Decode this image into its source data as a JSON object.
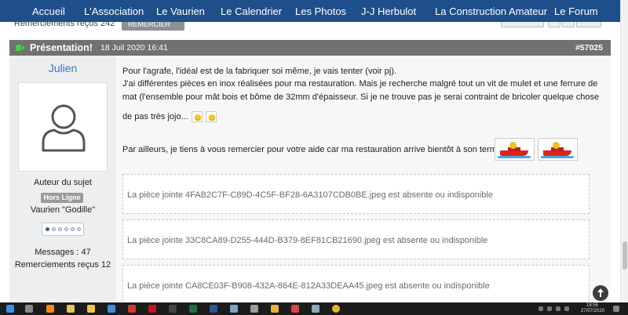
{
  "nav": {
    "items": [
      "Accueil",
      "L'Association",
      "Le Vaurien",
      "Le Calendrier",
      "Les Photos",
      "J-J Herbulot",
      "La Construction Amateur",
      "Le Forum"
    ]
  },
  "prev_post": {
    "thanks_text": "Remerciements reçus 242",
    "button_label": "REMERCIER"
  },
  "post": {
    "title": "Présentation!",
    "date": "18 Juil 2020 16:41",
    "number": "#57025",
    "author": {
      "name": "Julien",
      "role": "Auteur du sujet",
      "status": "Hors Ligne",
      "rank": "Vaurien \"Godille\"",
      "messages": "Messages : 47",
      "thanks": "Remerciements reçus 12"
    },
    "paragraphs": [
      "Pour l'agrafe, l'idéal est de la fabriquer soi même, je vais tenter (voir pj).",
      "J'ai différentes pièces en inox réalisées pour ma restauration. Mais je recherche malgré tout un vit de mulet et une ferrure de",
      "mat (l'ensemble pour mât bois et bôme de 32mm d'épaisseur. Si je ne trouve pas je serai contraint de bricoler quelque chose",
      "de pas très jojo...",
      "Par ailleurs, je tiens à vous remercier pour votre aide car ma restauration arrive bientôt à son terme!!!"
    ],
    "attachments": [
      "La pièce jointe 4FAB2C7F-C89D-4C5F-BF28-6A3107CDB0BE.jpeg est absente ou indisponible",
      "La pièce jointe 33C8CA89-D255-444D-B379-8EF81CB21690.jpeg est absente ou indisponible",
      "La pièce jointe CA8CE03F-B908-432A-864E-812A33DEAA45.jpeg est absente ou indisponible"
    ]
  },
  "taskbar": {
    "time": "18:55",
    "date": "27/07/2020"
  },
  "colors": {
    "nav_bg": "#1f4f8a",
    "post_header_bg": "#717171",
    "username": "#3a78b8",
    "online": "#3fd13f"
  }
}
